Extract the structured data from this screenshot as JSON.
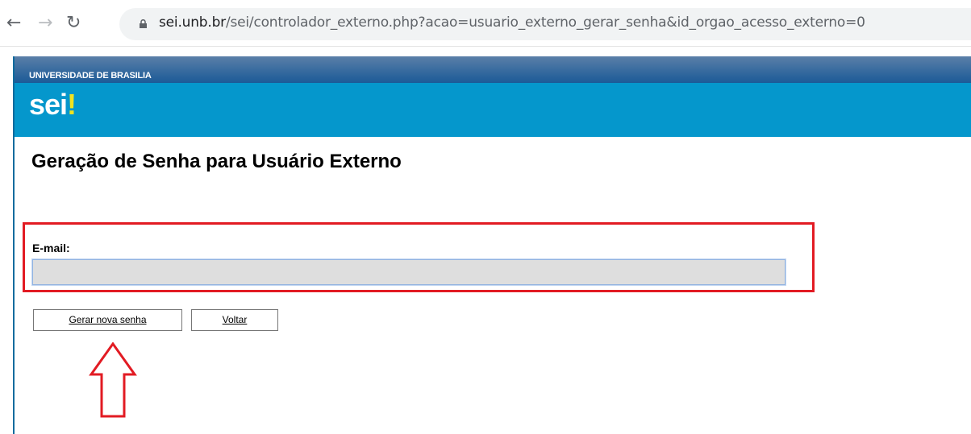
{
  "browser": {
    "url_host": "sei.unb.br",
    "url_path": "/sei/controlador_externo.php?acao=usuario_externo_gerar_senha&id_orgao_acesso_externo=0",
    "back_icon": "arrow-left-icon",
    "forward_icon": "arrow-right-icon",
    "reload_icon": "reload-icon",
    "lock_icon": "lock-icon"
  },
  "header": {
    "institution": "UNIVERSIDADE DE BRASILIA",
    "logo_text": "sei",
    "logo_mark": "!"
  },
  "page": {
    "title": "Geração de Senha para Usuário Externo"
  },
  "form": {
    "email_label": "E-mail:",
    "email_value": ""
  },
  "buttons": {
    "generate_label": "Gerar nova senha",
    "back_label": "Voltar"
  },
  "colors": {
    "institution_bar": "#1b5a97",
    "logo_bar": "#0597cc",
    "highlight": "#e21b23",
    "logo_mark": "#f1e31f"
  }
}
